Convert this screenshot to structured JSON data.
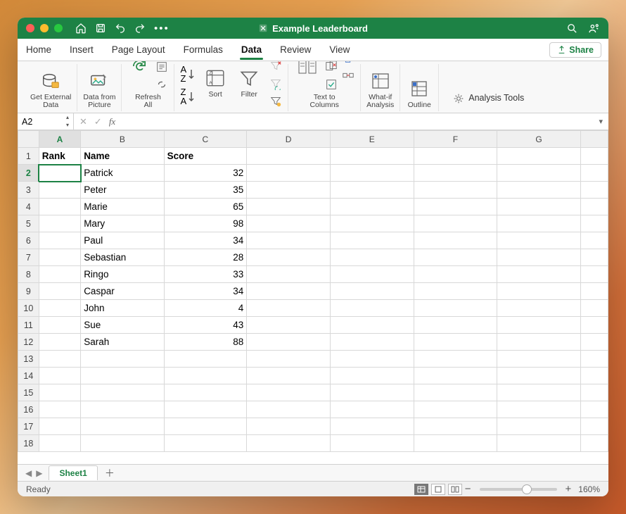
{
  "window": {
    "title": "Example Leaderboard"
  },
  "titlebar_icons": [
    "home",
    "save",
    "undo",
    "redo",
    "more"
  ],
  "titlebar_right": [
    "search",
    "share-workspace"
  ],
  "tabs": [
    "Home",
    "Insert",
    "Page Layout",
    "Formulas",
    "Data",
    "Review",
    "View"
  ],
  "active_tab": "Data",
  "share_label": "Share",
  "ribbon": {
    "g1": "Get External\nData",
    "g2": "Data from\nPicture",
    "g3": "Refresh\nAll",
    "g4a": "Sort",
    "g4b": "Filter",
    "g5": "Text to\nColumns",
    "g6": "What-if\nAnalysis",
    "g7": "Outline",
    "g8": "Analysis Tools"
  },
  "namebox": "A2",
  "formula": "",
  "columns": [
    "A",
    "B",
    "C",
    "D",
    "E",
    "F",
    "G"
  ],
  "selected_col": "A",
  "selected_row": 2,
  "header_row": {
    "A": "Rank",
    "B": "Name",
    "C": "Score"
  },
  "rows": [
    {
      "n": 2,
      "B": "Patrick",
      "C": 32
    },
    {
      "n": 3,
      "B": "Peter",
      "C": 35
    },
    {
      "n": 4,
      "B": "Marie",
      "C": 65
    },
    {
      "n": 5,
      "B": "Mary",
      "C": 98
    },
    {
      "n": 6,
      "B": "Paul",
      "C": 34
    },
    {
      "n": 7,
      "B": "Sebastian",
      "C": 28
    },
    {
      "n": 8,
      "B": "Ringo",
      "C": 33
    },
    {
      "n": 9,
      "B": "Caspar",
      "C": 34
    },
    {
      "n": 10,
      "B": "John",
      "C": 4
    },
    {
      "n": 11,
      "B": "Sue",
      "C": 43
    },
    {
      "n": 12,
      "B": "Sarah",
      "C": 88
    },
    {
      "n": 13
    },
    {
      "n": 14
    },
    {
      "n": 15
    },
    {
      "n": 16
    },
    {
      "n": 17
    },
    {
      "n": 18
    }
  ],
  "sheet_tab": "Sheet1",
  "status": "Ready",
  "zoom": "160%"
}
